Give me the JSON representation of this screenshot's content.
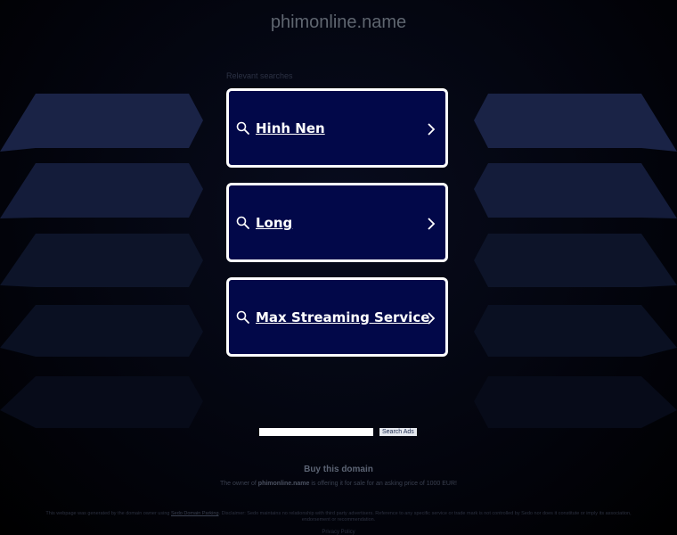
{
  "header": {
    "domain": "phimonline.name"
  },
  "search_section": {
    "label": "Relevant searches",
    "items": [
      {
        "label": "Hinh Nen"
      },
      {
        "label": "Long"
      },
      {
        "label": "Max Streaming Service"
      }
    ]
  },
  "search_bar": {
    "value": "",
    "button_label": "Search Ads"
  },
  "footer": {
    "buy_label": "Buy this domain",
    "owner_prefix": "The owner of",
    "owner_domain": "phimonline.name",
    "owner_suffix": "is offering it for sale for an asking price of 1000 EUR!",
    "disclaimer_prefix": "This webpage was generated by the domain owner using",
    "disclaimer_link": "Sedo Domain Parking",
    "disclaimer_suffix": ". Disclaimer: Sedo maintains no relationship with third party advertisers. Reference to any specific service or trade mark is not controlled by Sedo nor does it constitute or imply its association, endorsement or recommendation.",
    "privacy_label": "Privacy Policy"
  },
  "colors": {
    "card_bg": "#020849",
    "card_border": "#ffffff",
    "page_bg": "#000000"
  }
}
